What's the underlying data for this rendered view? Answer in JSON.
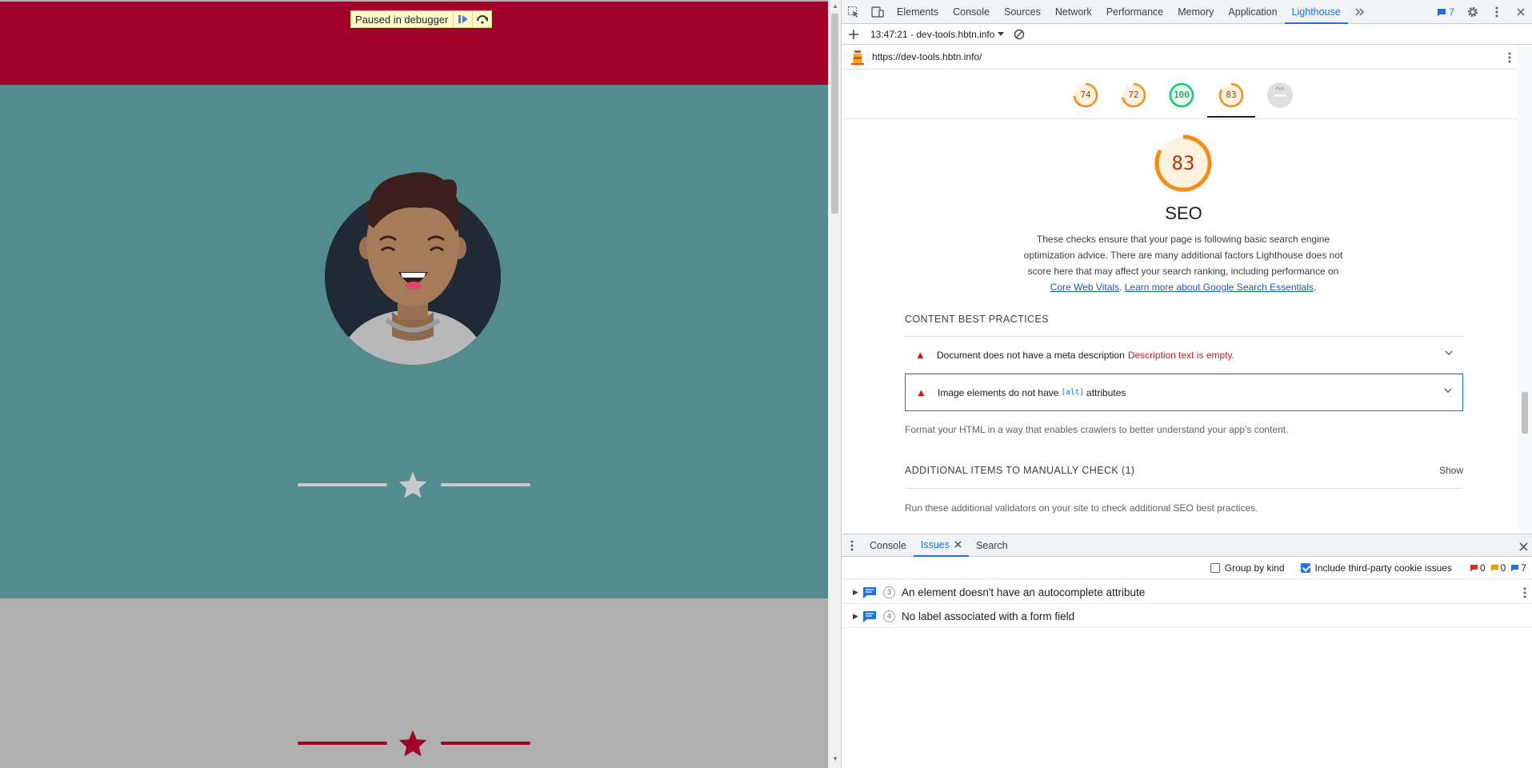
{
  "viewport": {
    "debugger": {
      "label": "Paused in debugger"
    }
  },
  "devtools": {
    "tabs": [
      "Elements",
      "Console",
      "Sources",
      "Network",
      "Performance",
      "Memory",
      "Application",
      "Lighthouse"
    ],
    "active_tab": "Lighthouse",
    "issues_count": "7",
    "lighthouse": {
      "report_selector": "13:47:21 - dev-tools.hbtn.info",
      "url": "https://dev-tools.hbtn.info/",
      "scores": [
        "74",
        "72",
        "100",
        "83"
      ],
      "pwa_label": "PWA",
      "seo": {
        "score": "83",
        "title": "SEO",
        "description": "These checks ensure that your page is following basic search engine optimization advice. There are many additional factors Lighthouse does not score here that may affect your search ranking, including performance on",
        "link_core_web_vitals": "Core Web Vitals",
        "link_learn_more": "Learn more about Google Search Essentials",
        "desc_end": "."
      },
      "content_best_practices": {
        "title": "CONTENT BEST PRACTICES",
        "audit1_label": "Document does not have a meta description",
        "audit1_detail": "Description text is empty.",
        "audit2_pre": "Image elements do not have",
        "audit2_code": "[alt]",
        "audit2_post": "attributes",
        "footer": "Format your HTML in a way that enables crawlers to better understand your app's content."
      },
      "manual": {
        "title": "ADDITIONAL ITEMS TO MANUALLY CHECK",
        "count": "(1)",
        "show_label": "Show",
        "footer": "Run these additional validators on your site to check additional SEO best practices."
      }
    },
    "drawer": {
      "tabs": [
        "Console",
        "Issues",
        "Search"
      ],
      "active_tab": "Issues",
      "group_by_kind": "Group by kind",
      "include_third_party": "Include third-party cookie issues",
      "counts": {
        "errors": "0",
        "warnings": "0",
        "info": "7"
      },
      "issues": [
        {
          "count": "3",
          "title": "An element doesn't have an autocomplete attribute"
        },
        {
          "count": "4",
          "title": "No label associated with a form field"
        }
      ]
    }
  },
  "colors": {
    "header_band": "#a0002a",
    "teal": "#538c8f",
    "gray": "#b0b0b0",
    "score_orange": "#fa8c14",
    "score_green": "#0cce6b",
    "accent": "#1a73e8"
  }
}
